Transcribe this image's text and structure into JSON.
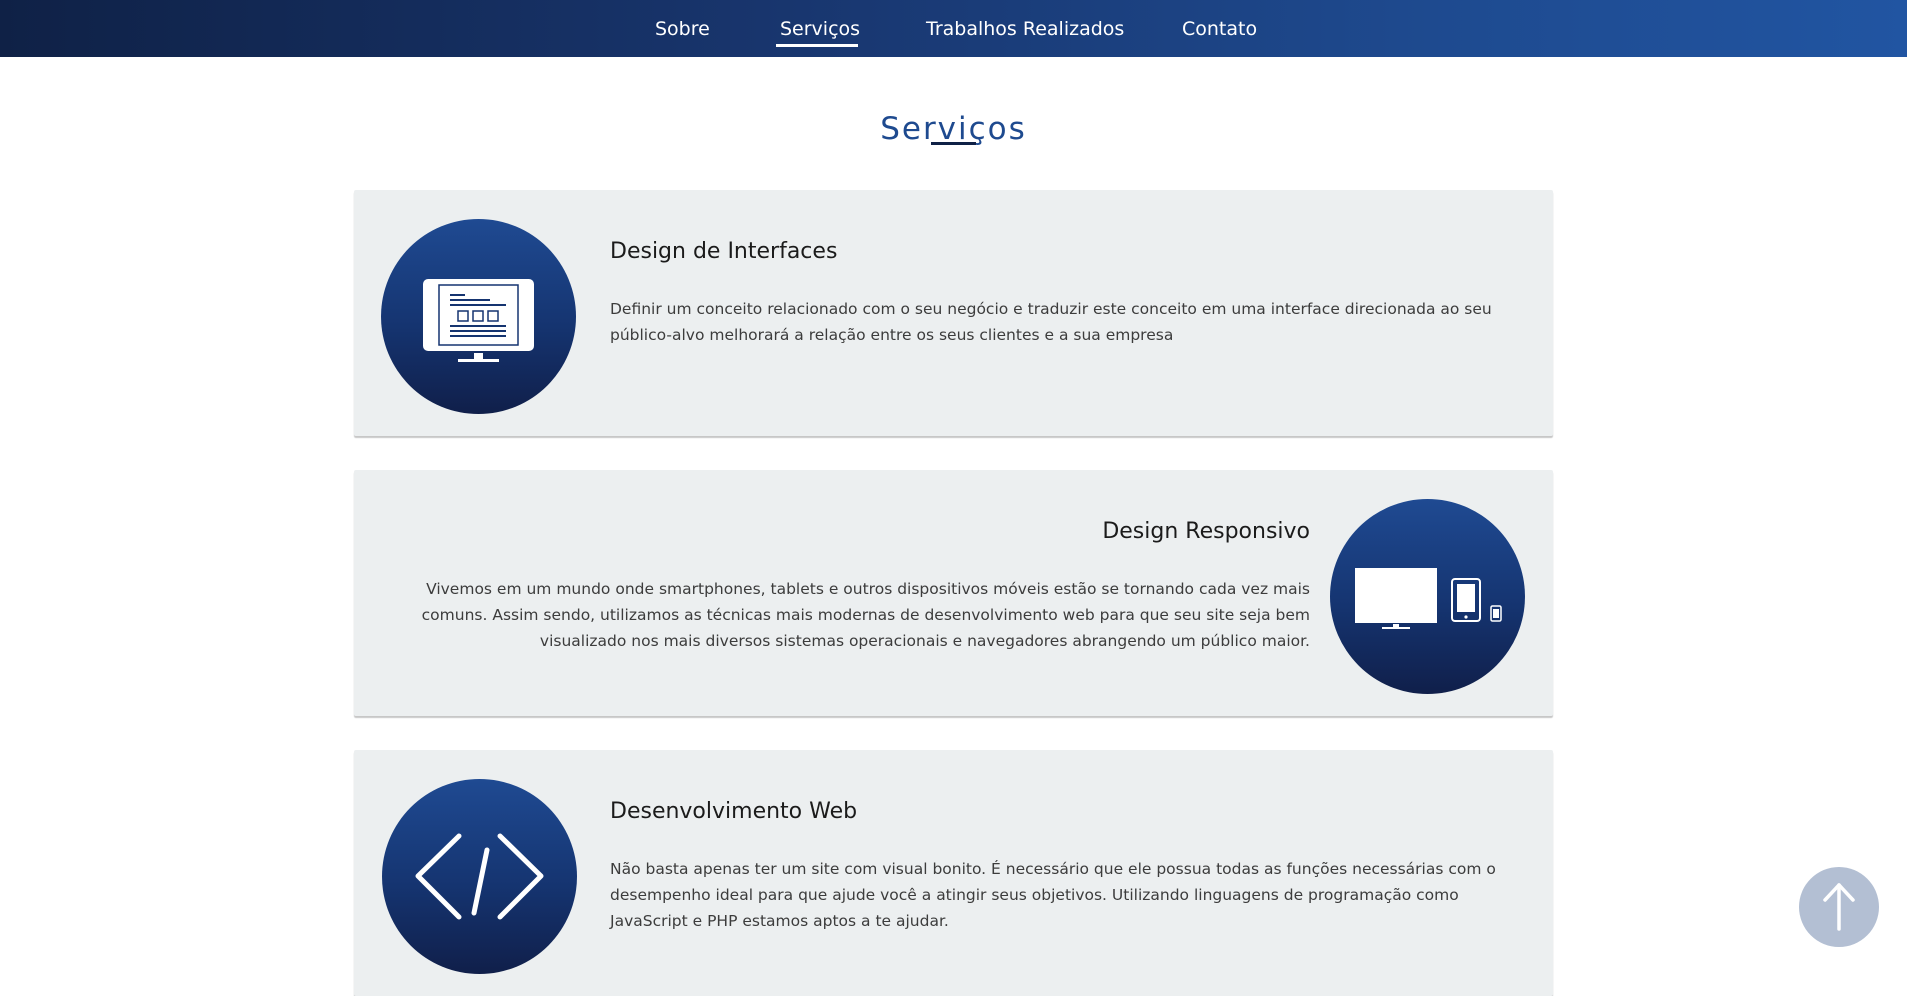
{
  "nav": {
    "items": [
      {
        "label": "Sobre"
      },
      {
        "label": "Serviços"
      },
      {
        "label": "Trabalhos Realizados"
      },
      {
        "label": "Contato"
      }
    ],
    "active_index": 1
  },
  "section": {
    "title": "Serviços"
  },
  "services": [
    {
      "title": "Design de Interfaces",
      "text": "Definir um conceito relacionado com o seu negócio e traduzir este conceito em uma interface direcionada ao seu público-alvo melhorará a relação entre os seus clientes e a sua empresa",
      "icon": "monitor-interface-icon"
    },
    {
      "title": "Design Responsivo",
      "text": "Vivemos em um mundo onde smartphones, tablets e outros dispositivos móveis estão se tornando cada vez mais comuns. Assim sendo, utilizamos as técnicas mais modernas de desenvolvimento web para que seu site seja bem visualizado nos mais diversos sistemas operacionais e navegadores abrangendo um público maior.",
      "icon": "responsive-devices-icon"
    },
    {
      "title": "Desenvolvimento Web",
      "text": "Não basta apenas ter um site com visual bonito. É necessário que ele possua todas as funções necessárias com o desempenho ideal para que ajude você a atingir seus objetivos. Utilizando linguagens de programação como JavaScript e PHP estamos aptos a te ajudar.",
      "icon": "code-brackets-icon"
    }
  ],
  "scroll_top": {
    "icon": "arrow-up-icon"
  },
  "colors": {
    "primary_dark": "#0f2146",
    "primary": "#1e4a8f",
    "card_bg": "#eceff0",
    "scroll_button": "#b3bfd3"
  }
}
